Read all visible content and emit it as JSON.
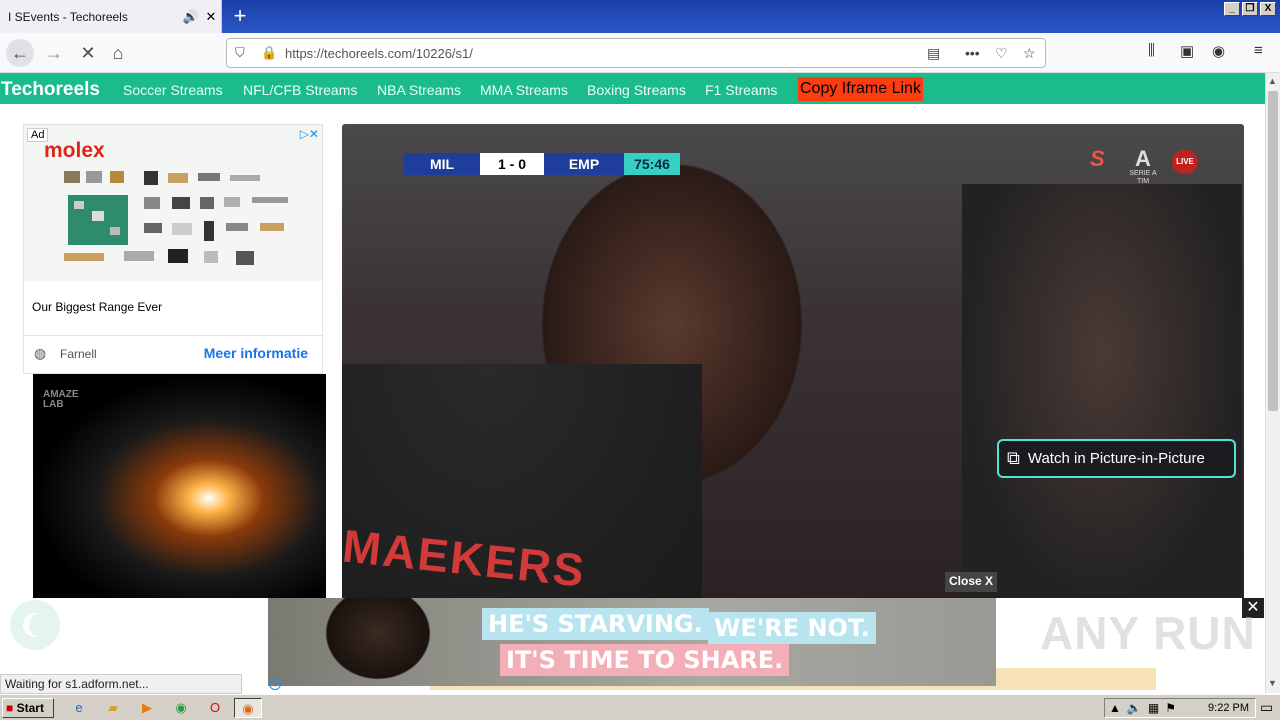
{
  "browser": {
    "tab_title": "I SEvents - Techoreels",
    "tab_audio_icon": "speaker-icon",
    "tab_close_icon": "close-icon",
    "new_tab": "+",
    "url": "https://techoreels.com/10226/s1/",
    "window_controls": [
      "_",
      "❐",
      "X"
    ]
  },
  "site": {
    "brand": "Techoreels",
    "nav": [
      "Soccer Streams",
      "NFL/CFB Streams",
      "NBA Streams",
      "MMA Streams",
      "Boxing Streams",
      "F1 Streams"
    ],
    "iframe_button": "Copy Iframe Link"
  },
  "ad_sidebar": {
    "tag": "Ad",
    "brand": "molex",
    "headline": "Our Biggest Range Ever",
    "advertiser": "Farnell",
    "cta": "Meer informatie"
  },
  "ad_sidebar_2": {
    "logo": "AMAZE\nLAB"
  },
  "video": {
    "team_home": "MIL",
    "score": "1 - 0",
    "team_away": "EMP",
    "clock": "75:46",
    "live_badge": "LIVE",
    "league": "SERIE A\nTIM",
    "shirt_text": "MAEKERS",
    "pip_label": "Watch in Picture-in-Picture"
  },
  "bottom_ad": {
    "close_label": "Close X",
    "line1a": "HE'S STARVING.",
    "line1b": "WE'RE NOT.",
    "line2": "IT'S TIME TO SHARE."
  },
  "status_text": "Waiting for s1.adform.net...",
  "watermark": "ANY RUN",
  "taskbar": {
    "start": "Start",
    "clock": "9:22 PM"
  }
}
